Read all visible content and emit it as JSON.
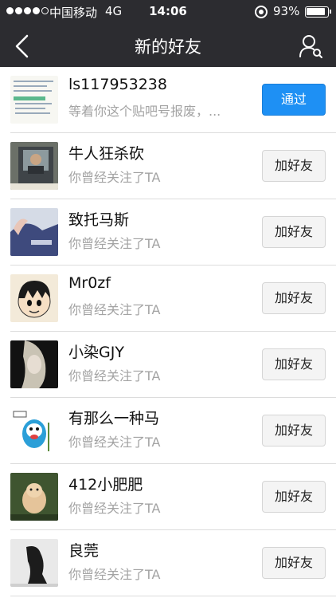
{
  "status_bar": {
    "carrier": "中国移动",
    "network": "4G",
    "time": "14:06",
    "battery_text": "93%",
    "battery_level": 0.93
  },
  "nav": {
    "title": "新的好友",
    "back_icon": "chevron-left-icon",
    "contacts_icon": "person-search-icon"
  },
  "colors": {
    "nav_bg": "#2c2c30",
    "accept_button": "#1e90f4",
    "subtext": "#a3a3a3"
  },
  "requests": [
    {
      "name": "ls117953238",
      "subtitle": "等着你这个贴吧号报废，...",
      "action": "通过",
      "action_type": "accept"
    },
    {
      "name": "牛人狂杀砍",
      "subtitle": "你曾经关注了TA",
      "action": "加好友",
      "action_type": "add"
    },
    {
      "name": "致托马斯",
      "subtitle": "你曾经关注了TA",
      "action": "加好友",
      "action_type": "add"
    },
    {
      "name": "Mr0zf",
      "subtitle": "你曾经关注了TA",
      "action": "加好友",
      "action_type": "add"
    },
    {
      "name": "小染GJY",
      "subtitle": "你曾经关注了TA",
      "action": "加好友",
      "action_type": "add"
    },
    {
      "name": "有那么一种马",
      "subtitle": "你曾经关注了TA",
      "action": "加好友",
      "action_type": "add"
    },
    {
      "name": "412小肥肥",
      "subtitle": "你曾经关注了TA",
      "action": "加好友",
      "action_type": "add"
    },
    {
      "name": "良莞",
      "subtitle": "你曾经关注了TA",
      "action": "加好友",
      "action_type": "add"
    }
  ]
}
